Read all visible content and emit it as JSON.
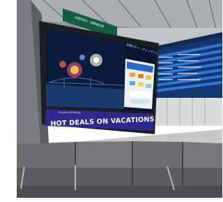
{
  "photo": {
    "ad_headline": "HOT DEALS ON VACATIONS AND CRUI",
    "ad_brand": "Perfect Holiday",
    "signage_left": "出国手続き・国際線出発",
    "signage_right": "出発ロビー・チェックイン"
  },
  "colors": {
    "ceiling": "#8f949a",
    "sky_blue": "#4c6fb5",
    "board_blue": "#1f5fc3",
    "seat_gray": "#6c6e71",
    "floor": "#c7c8ca"
  }
}
